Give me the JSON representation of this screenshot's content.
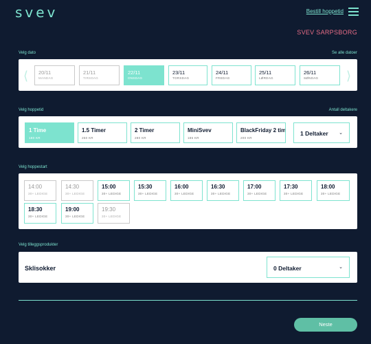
{
  "header": {
    "logo": "svev",
    "book_link": "Bestill hoppetid",
    "location": "SVEV SARPSBORG"
  },
  "dates": {
    "label": "Velg dato",
    "see_all": "Se alle datoer",
    "items": [
      {
        "date": "20/11",
        "day": "MANDAG"
      },
      {
        "date": "21/11",
        "day": "TIRSDAG"
      },
      {
        "date": "22/11",
        "day": "ONSDAG"
      },
      {
        "date": "23/11",
        "day": "TORSDAG"
      },
      {
        "date": "24/11",
        "day": "FREDAG"
      },
      {
        "date": "25/11",
        "day": "LØRDAG"
      },
      {
        "date": "26/11",
        "day": "SØNDAG"
      }
    ]
  },
  "jump": {
    "label": "Velg hoppetid",
    "participants_label": "Antall deltakere",
    "items": [
      {
        "name": "1 Time",
        "price": "180 KR"
      },
      {
        "name": "1.5 Timer",
        "price": "250 KR"
      },
      {
        "name": "2 Timer",
        "price": "280 KR"
      },
      {
        "name": "MiniSvev",
        "price": "185 KR"
      },
      {
        "name": "BlackFriday 2 tim...",
        "price": "200 KR"
      }
    ],
    "participants_value": "1 Deltaker"
  },
  "slots": {
    "label": "Velg hoppestart",
    "items": [
      {
        "time": "14:00",
        "avail": "30+ LEDIGE"
      },
      {
        "time": "14:30",
        "avail": "30+ LEDIGE"
      },
      {
        "time": "15:00",
        "avail": "30+ LEDIGE"
      },
      {
        "time": "15:30",
        "avail": "30+ LEDIGE"
      },
      {
        "time": "16:00",
        "avail": "30+ LEDIGE"
      },
      {
        "time": "16:30",
        "avail": "30+ LEDIGE"
      },
      {
        "time": "17:00",
        "avail": "30+ LEDIGE"
      },
      {
        "time": "17:30",
        "avail": "30+ LEDIGE"
      },
      {
        "time": "18:00",
        "avail": "30+ LEDIGE"
      },
      {
        "time": "18:30",
        "avail": "30+ LEDIGE"
      },
      {
        "time": "19:00",
        "avail": "30+ LEDIGE"
      },
      {
        "time": "19:30",
        "avail": "30+ LEDIGE"
      }
    ]
  },
  "addons": {
    "label": "Velg tilleggsprodukter",
    "item_name": "Sklisokker",
    "value": "0 Deltaker"
  },
  "next_label": "Neste",
  "colors": {
    "background": "#0f1b30",
    "accent": "#7de3cf",
    "location": "#e86d86",
    "button": "#5fbfa5"
  }
}
